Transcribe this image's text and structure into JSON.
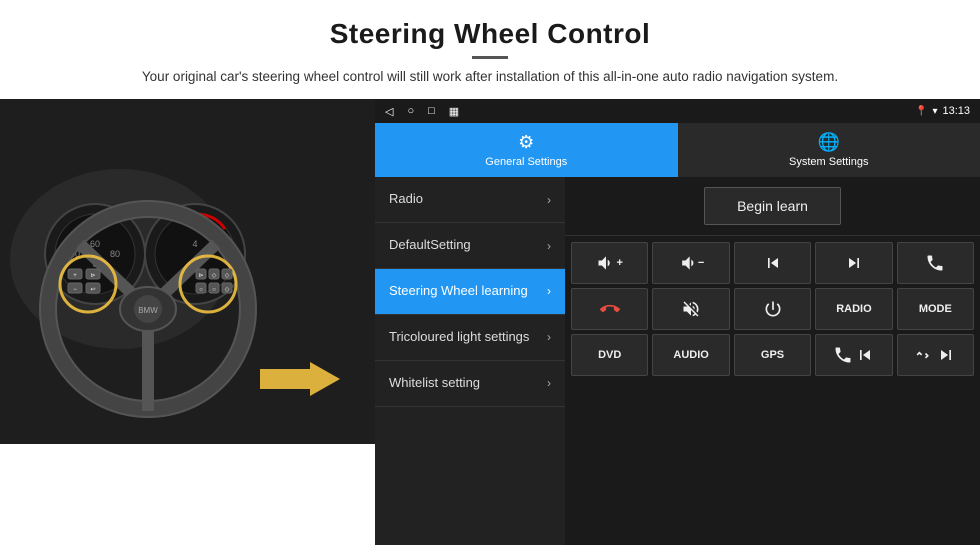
{
  "header": {
    "title": "Steering Wheel Control",
    "description": "Your original car's steering wheel control will still work after installation of this all-in-one auto radio navigation system."
  },
  "status_bar": {
    "time": "13:13",
    "icons": [
      "◁",
      "○",
      "□",
      "▦"
    ]
  },
  "tabs": [
    {
      "id": "general",
      "label": "General Settings",
      "active": true
    },
    {
      "id": "system",
      "label": "System Settings",
      "active": false
    }
  ],
  "menu_items": [
    {
      "id": "radio",
      "label": "Radio",
      "active": false
    },
    {
      "id": "default",
      "label": "DefaultSetting",
      "active": false
    },
    {
      "id": "steering",
      "label": "Steering Wheel learning",
      "active": true
    },
    {
      "id": "tricoloured",
      "label": "Tricoloured light settings",
      "active": false
    },
    {
      "id": "whitelist",
      "label": "Whitelist setting",
      "active": false
    }
  ],
  "begin_learn_label": "Begin learn",
  "control_rows": [
    [
      "vol_up",
      "vol_down",
      "prev_track",
      "next_track",
      "phone"
    ],
    [
      "hang_up",
      "mute",
      "power",
      "radio_btn",
      "mode"
    ],
    [
      "dvd",
      "audio",
      "gps",
      "vol_seek",
      "ff_rew"
    ]
  ]
}
